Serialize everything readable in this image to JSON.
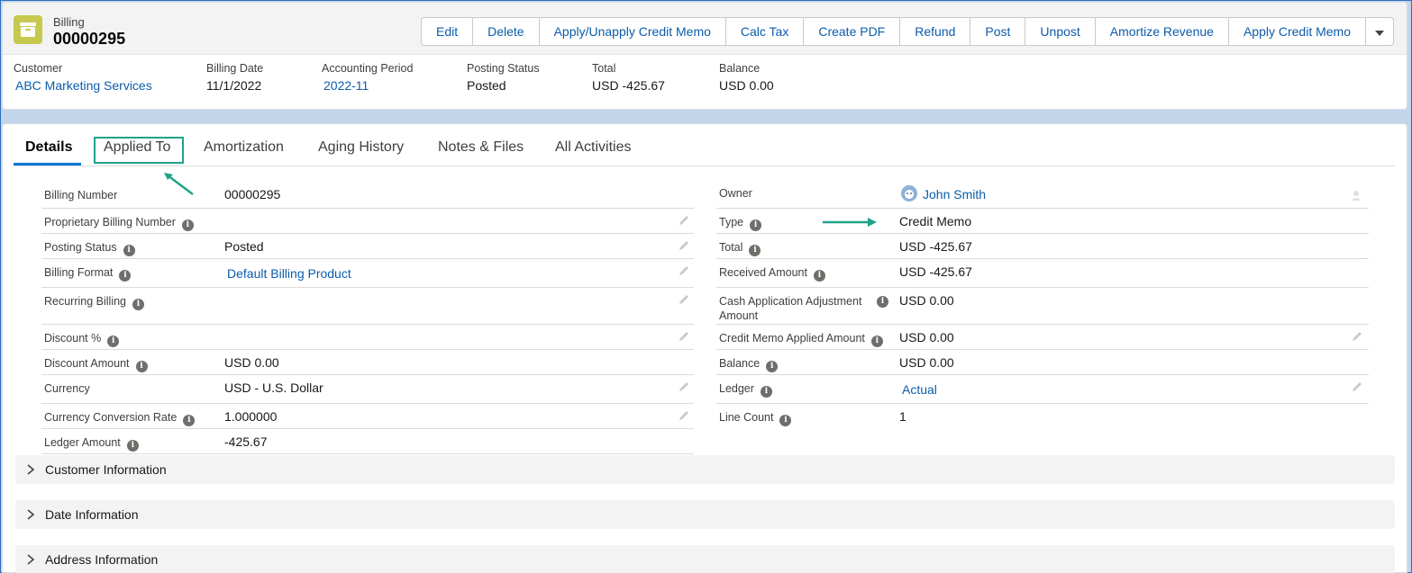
{
  "header": {
    "object_type": "Billing",
    "record_name": "00000295",
    "icon": "billing-icon",
    "buttons": [
      "Edit",
      "Delete",
      "Apply/Unapply Credit Memo",
      "Calc Tax",
      "Create PDF",
      "Refund",
      "Post",
      "Unpost",
      "Amortize Revenue",
      "Apply Credit Memo"
    ],
    "highlights": [
      {
        "label": "Customer",
        "value": "ABC Marketing Services",
        "link": true
      },
      {
        "label": "Billing Date",
        "value": "11/1/2022",
        "link": false
      },
      {
        "label": "Accounting Period",
        "value": "2022-11",
        "link": true
      },
      {
        "label": "Posting Status",
        "value": "Posted",
        "link": false
      },
      {
        "label": "Total",
        "value": "USD -425.67",
        "link": false
      },
      {
        "label": "Balance",
        "value": "USD 0.00",
        "link": false
      }
    ]
  },
  "tabs": [
    "Details",
    "Applied To",
    "Amortization",
    "Aging History",
    "Notes & Files",
    "All Activities"
  ],
  "left_fields": [
    {
      "label": "Billing Number",
      "value": "00000295"
    },
    {
      "label": "Proprietary Billing Number",
      "value": ""
    },
    {
      "label": "Posting Status",
      "value": "Posted"
    },
    {
      "label": "Billing Format",
      "value": "Default Billing Product"
    },
    {
      "label": "Recurring Billing",
      "value": ""
    },
    {
      "label": "Discount %",
      "value": ""
    },
    {
      "label": "Discount Amount",
      "value": "USD 0.00"
    },
    {
      "label": "Currency",
      "value": "USD - U.S. Dollar"
    },
    {
      "label": "Currency Conversion Rate",
      "value": "1.000000"
    },
    {
      "label": "Ledger Amount",
      "value": "-425.67"
    }
  ],
  "right_fields": [
    {
      "label": "Owner",
      "value": "John Smith"
    },
    {
      "label": "Type",
      "value": "Credit Memo"
    },
    {
      "label": "Total",
      "value": "USD -425.67"
    },
    {
      "label": "Received Amount",
      "value": "USD -425.67"
    },
    {
      "label_line1": "Cash Application Adjustment",
      "label_line2": "Amount",
      "value": "USD 0.00"
    },
    {
      "label": "Credit Memo Applied Amount",
      "value": "USD 0.00"
    },
    {
      "label": "Balance",
      "value": "USD 0.00"
    },
    {
      "label": "Ledger",
      "value": "Actual"
    },
    {
      "label": "Line Count",
      "value": "1"
    }
  ],
  "sections": [
    "Customer Information",
    "Date Information",
    "Address Information"
  ],
  "colors": {
    "link": "#0b5cab",
    "annotation": "#1fa38a",
    "icon_bg": "#c7c94f",
    "tab_active": "#0176d3"
  }
}
